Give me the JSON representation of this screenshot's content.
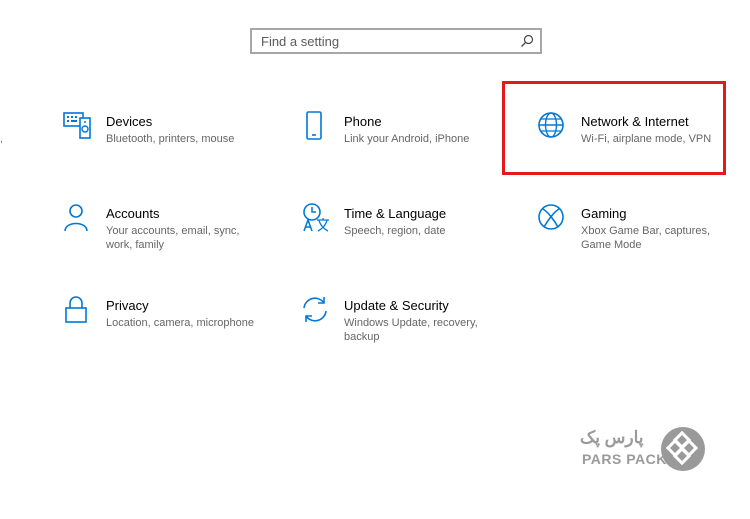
{
  "search": {
    "placeholder": "Find a setting"
  },
  "highlight_color": "#e21a1a",
  "accent_color": "#0078d7",
  "tiles": [
    {
      "title": "Devices",
      "desc": "Bluetooth, printers, mouse",
      "icon": "keyboard-icon"
    },
    {
      "title": "Phone",
      "desc": "Link your Android, iPhone",
      "icon": "phone-icon"
    },
    {
      "title": "Network & Internet",
      "desc": "Wi-Fi, airplane mode, VPN",
      "icon": "globe-icon"
    },
    {
      "title": "Accounts",
      "desc": "Your accounts, email, sync, work, family",
      "icon": "person-icon"
    },
    {
      "title": "Time & Language",
      "desc": "Speech, region, date",
      "icon": "time-language-icon"
    },
    {
      "title": "Gaming",
      "desc": "Xbox Game Bar, captures, Game Mode",
      "icon": "xbox-icon"
    },
    {
      "title": "Privacy",
      "desc": "Location, camera, microphone",
      "icon": "lock-icon"
    },
    {
      "title": "Update & Security",
      "desc": "Windows Update, recovery, backup",
      "icon": "sync-icon"
    }
  ],
  "watermark": {
    "fa": "پارس پک",
    "en": "PARS PACK"
  }
}
